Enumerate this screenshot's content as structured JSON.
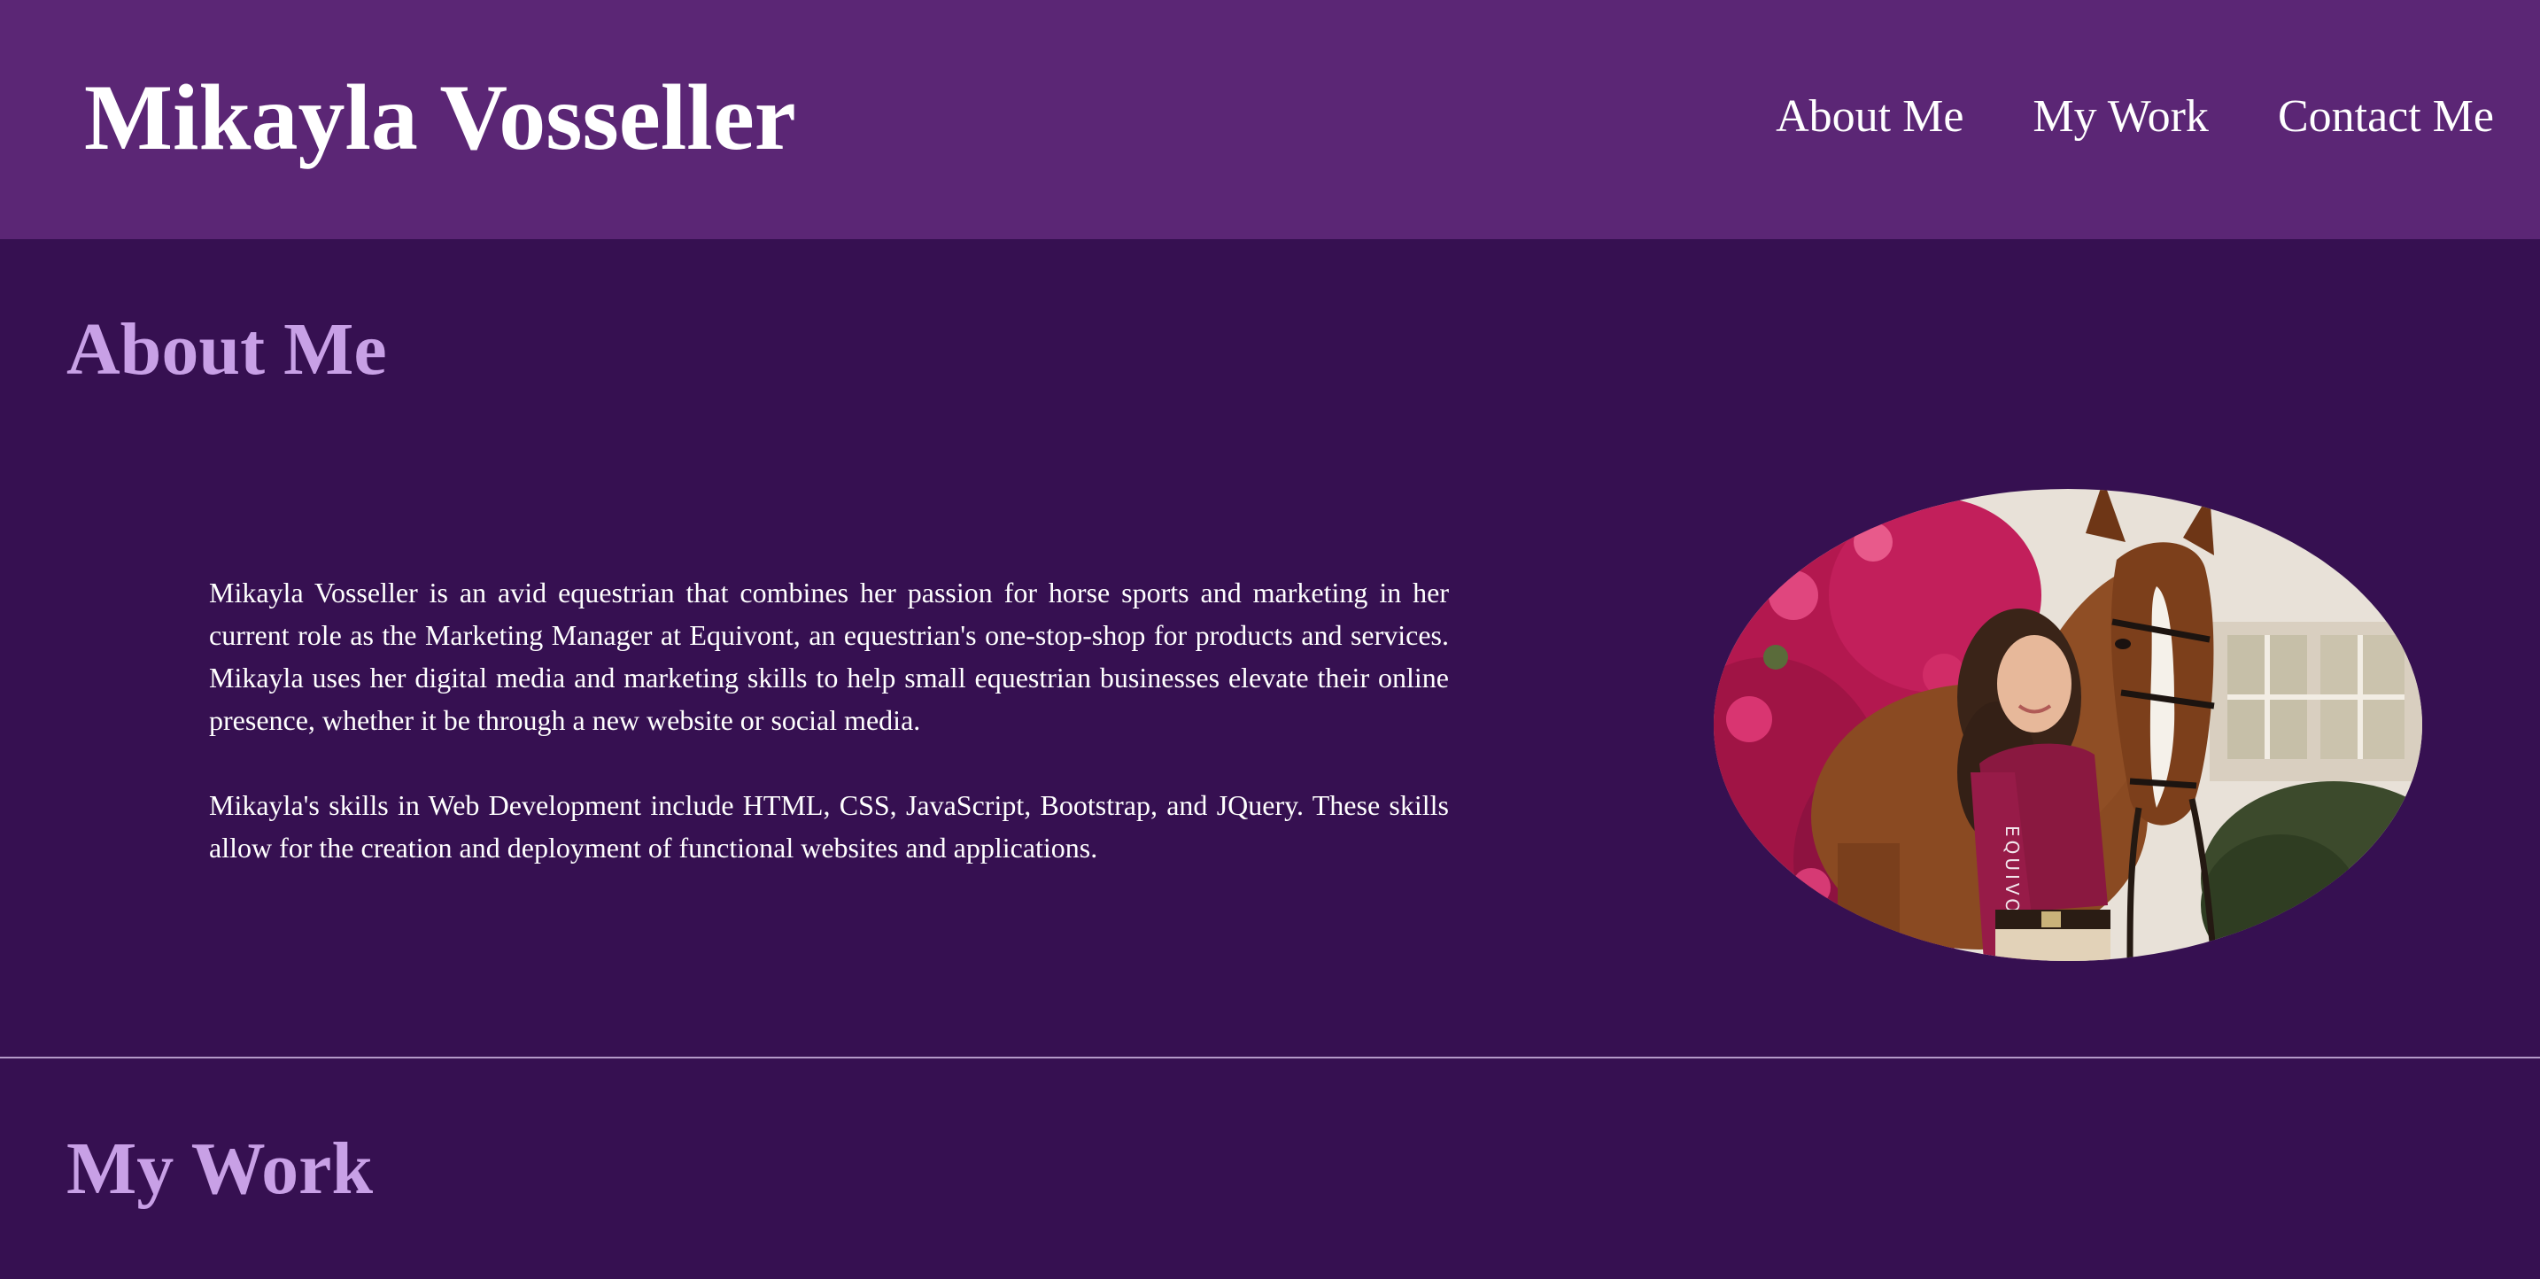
{
  "header": {
    "title": "Mikayla Vosseller",
    "nav": [
      {
        "label": "About Me"
      },
      {
        "label": "My Work"
      },
      {
        "label": "Contact Me"
      }
    ]
  },
  "about": {
    "heading": "About Me",
    "paragraphs": [
      "Mikayla Vosseller is an avid equestrian that combines her passion for horse sports and marketing in her current role as the Marketing Manager at Equivont, an equestrian's one-stop-shop for products and services. Mikayla uses her digital media and marketing skills to help small equestrian businesses elevate their online presence, whether it be through a new website or social media.",
      "Mikayla's skills in Web Development include HTML, CSS, JavaScript, Bootstrap, and JQuery. These skills allow for the creation and deployment of functional websites and applications."
    ],
    "photo": {
      "sleeve_text": "EQUIVONT"
    }
  },
  "work": {
    "heading": "My Work"
  },
  "colors": {
    "header_bg": "#5b2675",
    "page_bg": "#361051",
    "heading": "#c8a0e6",
    "text": "#ffffff"
  }
}
